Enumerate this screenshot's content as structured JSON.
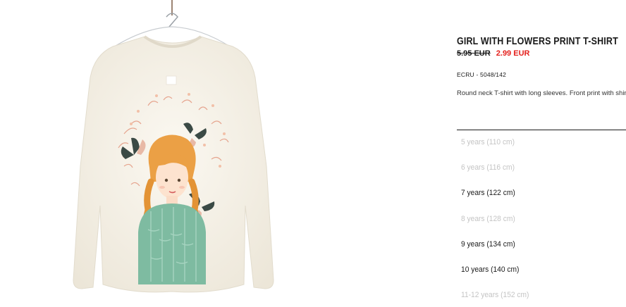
{
  "product": {
    "title": "GIRL WITH FLOWERS PRINT T-SHIRT",
    "price_old": "5.95 EUR",
    "price_new": "2.99 EUR",
    "reference": "ECRU - 5048/142",
    "description": "Round neck T-shirt with long sleeves. Front print with shiny motifs."
  },
  "sizes": [
    {
      "label": "5 years (110 cm)",
      "available": false
    },
    {
      "label": "6 years (116 cm)",
      "available": false
    },
    {
      "label": "7 years (122 cm)",
      "available": true
    },
    {
      "label": "8 years (128 cm)",
      "available": false
    },
    {
      "label": "9 years (134 cm)",
      "available": true
    },
    {
      "label": "10 years (140 cm)",
      "available": true
    },
    {
      "label": "11-12 years (152 cm)",
      "available": false
    }
  ],
  "colors": {
    "sale_price": "#e4201c",
    "unavailable_text": "#c4c4c4",
    "shirt": "#f6f2e8",
    "sweater": "#7ebba1",
    "hair": "#eba045"
  },
  "icons": [
    "hanger-icon",
    "butterfly-icon"
  ]
}
